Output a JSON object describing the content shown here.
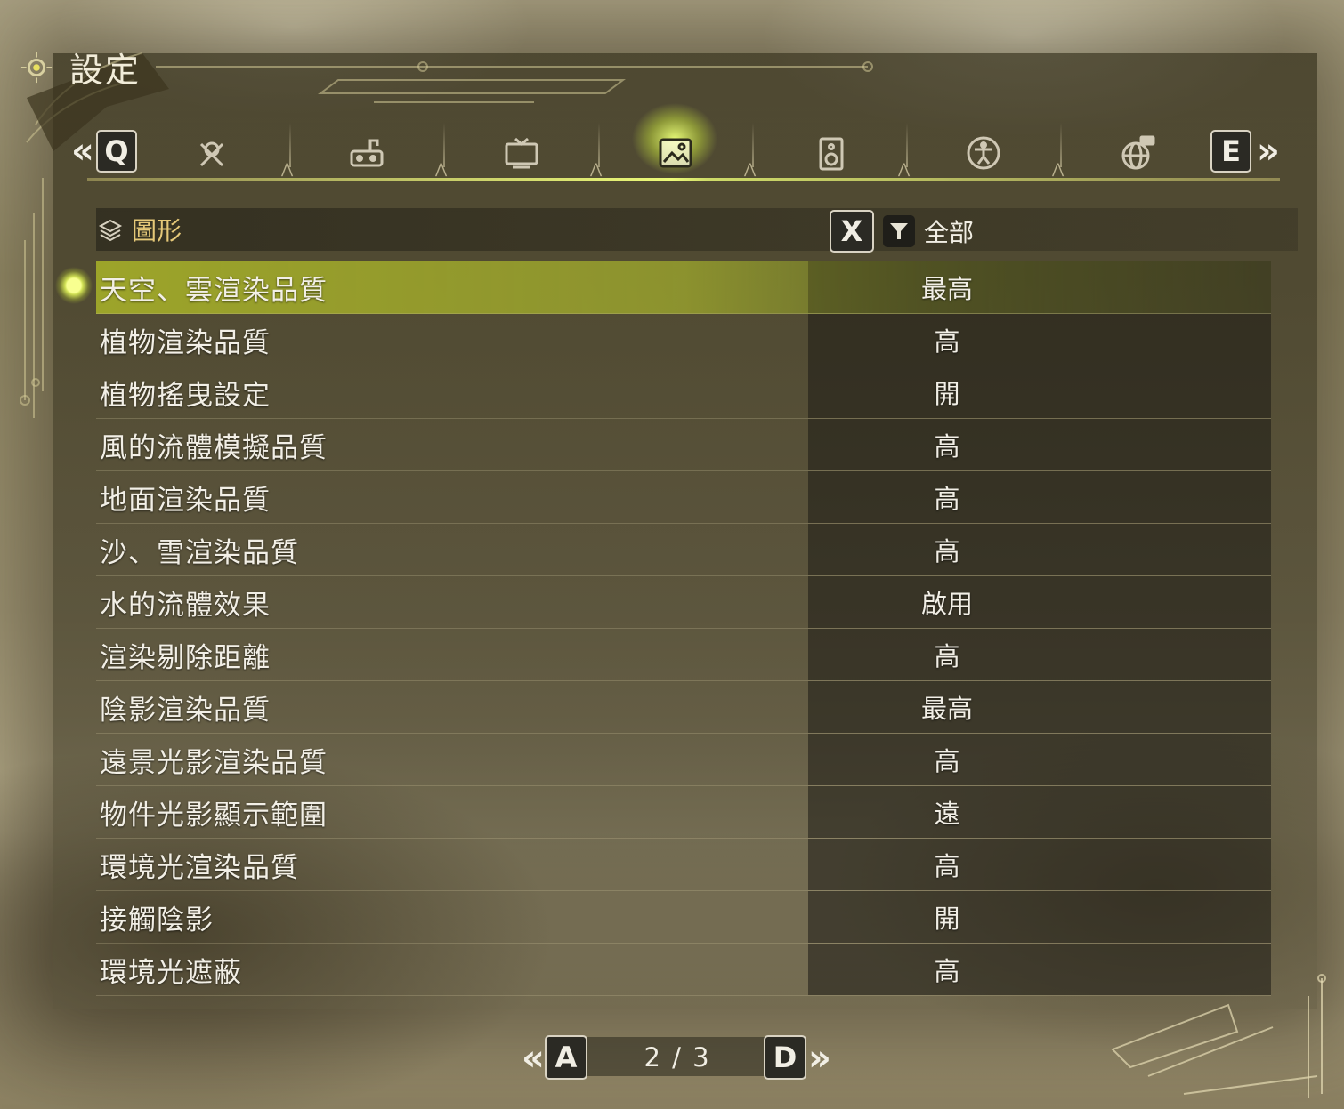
{
  "title": {
    "text": "設定"
  },
  "tabs": {
    "prev_key": "Q",
    "next_key": "E",
    "items": [
      {
        "icon": "tools-icon",
        "active": false
      },
      {
        "icon": "gamepad-icon",
        "active": false
      },
      {
        "icon": "monitor-icon",
        "active": false
      },
      {
        "icon": "image-icon",
        "active": true
      },
      {
        "icon": "speaker-icon",
        "active": false
      },
      {
        "icon": "accessibility-icon",
        "active": false
      },
      {
        "icon": "globe-network-icon",
        "active": false
      }
    ]
  },
  "section": {
    "label": "圖形"
  },
  "filter": {
    "key": "X",
    "label": "全部"
  },
  "settings": [
    {
      "label": "天空、雲渲染品質",
      "value": "最高",
      "selected": true
    },
    {
      "label": "植物渲染品質",
      "value": "高"
    },
    {
      "label": "植物搖曳設定",
      "value": "開"
    },
    {
      "label": "風的流體模擬品質",
      "value": "高"
    },
    {
      "label": "地面渲染品質",
      "value": "高"
    },
    {
      "label": "沙、雪渲染品質",
      "value": "高"
    },
    {
      "label": "水的流體效果",
      "value": "啟用"
    },
    {
      "label": "渲染剔除距離",
      "value": "高"
    },
    {
      "label": "陰影渲染品質",
      "value": "最高"
    },
    {
      "label": "遠景光影渲染品質",
      "value": "高"
    },
    {
      "label": "物件光影顯示範圍",
      "value": "遠"
    },
    {
      "label": "環境光渲染品質",
      "value": "高"
    },
    {
      "label": "接觸陰影",
      "value": "開"
    },
    {
      "label": "環境光遮蔽",
      "value": "高"
    }
  ],
  "pager": {
    "prev_key": "A",
    "next_key": "D",
    "page_text": "2 / 3"
  },
  "colors": {
    "accent": "#e2f25a",
    "section_label": "#e5c878",
    "text": "#f2efe6"
  }
}
